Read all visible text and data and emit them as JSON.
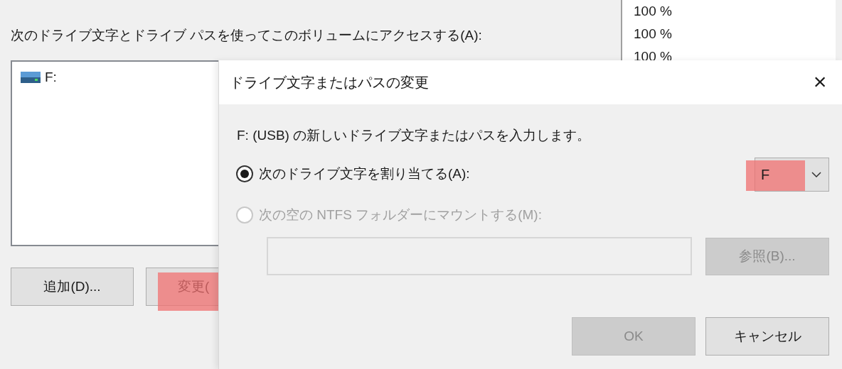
{
  "background_window": {
    "label": "次のドライブ文字とドライブ パスを使ってこのボリュームにアクセスする(A):",
    "volumes": [
      {
        "name": "F:",
        "selected": false
      }
    ],
    "buttons": [
      {
        "label": "追加(D)...",
        "highlighted": false
      },
      {
        "label": "変更(",
        "highlighted": true
      }
    ]
  },
  "side_list": {
    "rows": [
      "100 %",
      "100 %",
      "100 %"
    ]
  },
  "dialog": {
    "title": "ドライブ文字またはパスの変更",
    "close": "×",
    "prompt": "F: (USB) の新しいドライブ文字またはパスを入力します。",
    "options": [
      {
        "label": "次のドライブ文字を割り当てる(A):",
        "selected": true,
        "disabled": false
      },
      {
        "label": "次の空の NTFS フォルダーにマウントする(M):",
        "selected": false,
        "disabled": true
      }
    ],
    "drive_letter": {
      "value": "F",
      "highlighted": true
    },
    "folder_field": {
      "disabled": true
    },
    "browse_button": {
      "label": "参照(B)...",
      "disabled": true
    },
    "buttons": [
      {
        "label": "OK",
        "disabled": true
      },
      {
        "label": "キャンセル",
        "disabled": false
      }
    ]
  }
}
